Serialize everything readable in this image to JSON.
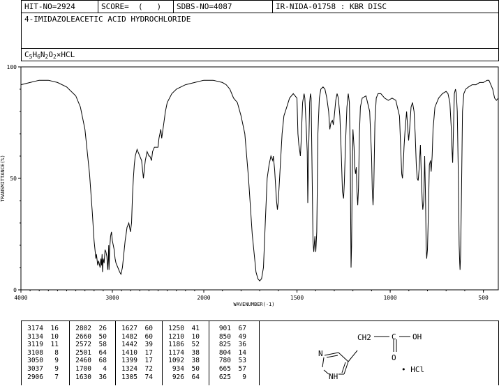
{
  "header": {
    "hit_no": "HIT-NO=2924",
    "score": "SCORE=  (   )",
    "sdbs_no": "SDBS-NO=4087",
    "ir_no": "IR-NIDA-01758 : KBR DISC"
  },
  "compound_name": "4-IMIDAZOLEACETIC ACID HYDROCHLORIDE",
  "formula": {
    "parts": [
      {
        "t": "C",
        "sub": false
      },
      {
        "t": "5",
        "sub": true
      },
      {
        "t": "H",
        "sub": false
      },
      {
        "t": "6",
        "sub": true
      },
      {
        "t": "N",
        "sub": false
      },
      {
        "t": "2",
        "sub": true
      },
      {
        "t": "O",
        "sub": false
      },
      {
        "t": "2",
        "sub": true
      },
      {
        "t": "×HCL",
        "sub": false
      }
    ]
  },
  "chart_data": {
    "type": "line",
    "xlabel": "WAVENUMBER(-1)",
    "ylabel": "TRANSMITTANCE(%)",
    "xlim": [
      4000,
      420
    ],
    "ylim": [
      0,
      100
    ],
    "xticks": [
      4000,
      3000,
      2000,
      1500,
      1000,
      500
    ],
    "yticks": [
      0,
      50,
      100
    ],
    "series": [
      {
        "points": [
          [
            4000,
            92
          ],
          [
            3900,
            93
          ],
          [
            3800,
            94
          ],
          [
            3700,
            94
          ],
          [
            3600,
            93
          ],
          [
            3500,
            91
          ],
          [
            3400,
            87
          ],
          [
            3350,
            82
          ],
          [
            3300,
            72
          ],
          [
            3250,
            52
          ],
          [
            3220,
            35
          ],
          [
            3200,
            22
          ],
          [
            3180,
            14
          ],
          [
            3174,
            16
          ],
          [
            3160,
            11
          ],
          [
            3150,
            13
          ],
          [
            3134,
            10
          ],
          [
            3125,
            14
          ],
          [
            3119,
            11
          ],
          [
            3112,
            16
          ],
          [
            3108,
            8
          ],
          [
            3100,
            14
          ],
          [
            3090,
            12
          ],
          [
            3080,
            18
          ],
          [
            3070,
            17
          ],
          [
            3060,
            15
          ],
          [
            3050,
            9
          ],
          [
            3045,
            14
          ],
          [
            3040,
            20
          ],
          [
            3037,
            9
          ],
          [
            3030,
            18
          ],
          [
            3020,
            24
          ],
          [
            3010,
            26
          ],
          [
            3000,
            22
          ],
          [
            2990,
            20
          ],
          [
            2980,
            18
          ],
          [
            2970,
            14
          ],
          [
            2960,
            12
          ],
          [
            2940,
            10
          ],
          [
            2920,
            8
          ],
          [
            2906,
            7
          ],
          [
            2890,
            10
          ],
          [
            2880,
            14
          ],
          [
            2870,
            18
          ],
          [
            2860,
            22
          ],
          [
            2850,
            25
          ],
          [
            2840,
            28
          ],
          [
            2820,
            30
          ],
          [
            2802,
            26
          ],
          [
            2790,
            30
          ],
          [
            2780,
            42
          ],
          [
            2770,
            50
          ],
          [
            2760,
            56
          ],
          [
            2750,
            60
          ],
          [
            2730,
            63
          ],
          [
            2710,
            61
          ],
          [
            2700,
            60
          ],
          [
            2680,
            58
          ],
          [
            2660,
            50
          ],
          [
            2650,
            54
          ],
          [
            2640,
            58
          ],
          [
            2620,
            62
          ],
          [
            2600,
            60
          ],
          [
            2590,
            60
          ],
          [
            2572,
            58
          ],
          [
            2560,
            62
          ],
          [
            2540,
            64
          ],
          [
            2520,
            64
          ],
          [
            2501,
            64
          ],
          [
            2490,
            68
          ],
          [
            2470,
            72
          ],
          [
            2460,
            68
          ],
          [
            2440,
            74
          ],
          [
            2420,
            80
          ],
          [
            2400,
            84
          ],
          [
            2350,
            88
          ],
          [
            2300,
            90
          ],
          [
            2200,
            92
          ],
          [
            2100,
            93
          ],
          [
            2000,
            94
          ],
          [
            1950,
            94
          ],
          [
            1900,
            93
          ],
          [
            1880,
            92
          ],
          [
            1860,
            90
          ],
          [
            1840,
            86
          ],
          [
            1820,
            84
          ],
          [
            1800,
            78
          ],
          [
            1780,
            70
          ],
          [
            1760,
            50
          ],
          [
            1740,
            25
          ],
          [
            1720,
            8
          ],
          [
            1710,
            5
          ],
          [
            1700,
            4
          ],
          [
            1690,
            5
          ],
          [
            1680,
            10
          ],
          [
            1670,
            30
          ],
          [
            1660,
            50
          ],
          [
            1650,
            56
          ],
          [
            1640,
            60
          ],
          [
            1630,
            58
          ],
          [
            1627,
            60
          ],
          [
            1620,
            54
          ],
          [
            1610,
            40
          ],
          [
            1605,
            36
          ],
          [
            1600,
            40
          ],
          [
            1590,
            55
          ],
          [
            1580,
            70
          ],
          [
            1570,
            78
          ],
          [
            1555,
            82
          ],
          [
            1540,
            86
          ],
          [
            1520,
            88
          ],
          [
            1500,
            86
          ],
          [
            1495,
            70
          ],
          [
            1490,
            65
          ],
          [
            1485,
            62
          ],
          [
            1482,
            60
          ],
          [
            1478,
            66
          ],
          [
            1470,
            84
          ],
          [
            1462,
            88
          ],
          [
            1458,
            86
          ],
          [
            1450,
            72
          ],
          [
            1445,
            62
          ],
          [
            1442,
            39
          ],
          [
            1438,
            60
          ],
          [
            1432,
            84
          ],
          [
            1428,
            88
          ],
          [
            1424,
            86
          ],
          [
            1420,
            60
          ],
          [
            1414,
            22
          ],
          [
            1410,
            17
          ],
          [
            1404,
            24
          ],
          [
            1399,
            17
          ],
          [
            1394,
            26
          ],
          [
            1388,
            70
          ],
          [
            1380,
            86
          ],
          [
            1372,
            90
          ],
          [
            1360,
            91
          ],
          [
            1350,
            90
          ],
          [
            1340,
            86
          ],
          [
            1330,
            80
          ],
          [
            1324,
            72
          ],
          [
            1318,
            75
          ],
          [
            1310,
            76
          ],
          [
            1305,
            74
          ],
          [
            1300,
            78
          ],
          [
            1292,
            85
          ],
          [
            1285,
            88
          ],
          [
            1278,
            86
          ],
          [
            1270,
            78
          ],
          [
            1262,
            60
          ],
          [
            1256,
            44
          ],
          [
            1250,
            41
          ],
          [
            1246,
            48
          ],
          [
            1240,
            65
          ],
          [
            1232,
            82
          ],
          [
            1225,
            88
          ],
          [
            1219,
            84
          ],
          [
            1214,
            60
          ],
          [
            1212,
            30
          ],
          [
            1210,
            10
          ],
          [
            1207,
            20
          ],
          [
            1204,
            50
          ],
          [
            1200,
            72
          ],
          [
            1194,
            64
          ],
          [
            1190,
            55
          ],
          [
            1186,
            52
          ],
          [
            1182,
            55
          ],
          [
            1178,
            44
          ],
          [
            1174,
            38
          ],
          [
            1170,
            46
          ],
          [
            1165,
            70
          ],
          [
            1160,
            82
          ],
          [
            1150,
            86
          ],
          [
            1130,
            87
          ],
          [
            1110,
            80
          ],
          [
            1100,
            60
          ],
          [
            1096,
            45
          ],
          [
            1092,
            38
          ],
          [
            1088,
            46
          ],
          [
            1082,
            75
          ],
          [
            1075,
            86
          ],
          [
            1065,
            88
          ],
          [
            1050,
            88
          ],
          [
            1030,
            86
          ],
          [
            1010,
            85
          ],
          [
            990,
            86
          ],
          [
            970,
            85
          ],
          [
            950,
            78
          ],
          [
            942,
            60
          ],
          [
            938,
            52
          ],
          [
            934,
            50
          ],
          [
            930,
            56
          ],
          [
            926,
            64
          ],
          [
            920,
            72
          ],
          [
            912,
            80
          ],
          [
            907,
            74
          ],
          [
            901,
            67
          ],
          [
            896,
            72
          ],
          [
            888,
            82
          ],
          [
            880,
            84
          ],
          [
            872,
            80
          ],
          [
            866,
            70
          ],
          [
            860,
            56
          ],
          [
            855,
            50
          ],
          [
            850,
            49
          ],
          [
            845,
            54
          ],
          [
            838,
            65
          ],
          [
            832,
            48
          ],
          [
            828,
            40
          ],
          [
            825,
            36
          ],
          [
            820,
            40
          ],
          [
            815,
            60
          ],
          [
            810,
            40
          ],
          [
            807,
            20
          ],
          [
            804,
            14
          ],
          [
            800,
            18
          ],
          [
            795,
            34
          ],
          [
            790,
            56
          ],
          [
            784,
            58
          ],
          [
            780,
            53
          ],
          [
            775,
            60
          ],
          [
            770,
            72
          ],
          [
            760,
            82
          ],
          [
            740,
            86
          ],
          [
            720,
            88
          ],
          [
            700,
            89
          ],
          [
            690,
            88
          ],
          [
            680,
            84
          ],
          [
            672,
            72
          ],
          [
            668,
            62
          ],
          [
            665,
            57
          ],
          [
            661,
            70
          ],
          [
            656,
            88
          ],
          [
            650,
            90
          ],
          [
            645,
            88
          ],
          [
            640,
            80
          ],
          [
            634,
            50
          ],
          [
            630,
            20
          ],
          [
            627,
            12
          ],
          [
            625,
            9
          ],
          [
            622,
            16
          ],
          [
            618,
            40
          ],
          [
            612,
            80
          ],
          [
            605,
            88
          ],
          [
            595,
            90
          ],
          [
            580,
            91
          ],
          [
            560,
            92
          ],
          [
            540,
            92
          ],
          [
            520,
            93
          ],
          [
            500,
            93
          ],
          [
            480,
            94
          ],
          [
            470,
            94
          ],
          [
            460,
            92
          ],
          [
            450,
            90
          ],
          [
            440,
            86
          ],
          [
            430,
            85
          ],
          [
            420,
            86
          ]
        ]
      }
    ]
  },
  "peaks": [
    [
      [
        "3174",
        "16"
      ],
      [
        "3134",
        "10"
      ],
      [
        "3119",
        "11"
      ],
      [
        "3108",
        "8"
      ],
      [
        "3050",
        "9"
      ],
      [
        "3037",
        "9"
      ],
      [
        "2906",
        "7"
      ]
    ],
    [
      [
        "2802",
        "26"
      ],
      [
        "2660",
        "50"
      ],
      [
        "2572",
        "58"
      ],
      [
        "2501",
        "64"
      ],
      [
        "2460",
        "68"
      ],
      [
        "1700",
        "4"
      ],
      [
        "1630",
        "36"
      ]
    ],
    [
      [
        "1627",
        "60"
      ],
      [
        "1482",
        "60"
      ],
      [
        "1442",
        "39"
      ],
      [
        "1410",
        "17"
      ],
      [
        "1399",
        "17"
      ],
      [
        "1324",
        "72"
      ],
      [
        "1305",
        "74"
      ]
    ],
    [
      [
        "1250",
        "41"
      ],
      [
        "1210",
        "10"
      ],
      [
        "1186",
        "52"
      ],
      [
        "1174",
        "38"
      ],
      [
        "1092",
        "38"
      ],
      [
        "934",
        "50"
      ],
      [
        "926",
        "64"
      ]
    ],
    [
      [
        "901",
        "67"
      ],
      [
        "850",
        "49"
      ],
      [
        "825",
        "36"
      ],
      [
        "804",
        "14"
      ],
      [
        "780",
        "53"
      ],
      [
        "665",
        "57"
      ],
      [
        "625",
        "9"
      ]
    ]
  ],
  "structure": {
    "ch2": "CH2",
    "c": "C",
    "oh": "OH",
    "o": "O",
    "n": "N",
    "nh": "NH",
    "hcl": "• HCl"
  }
}
